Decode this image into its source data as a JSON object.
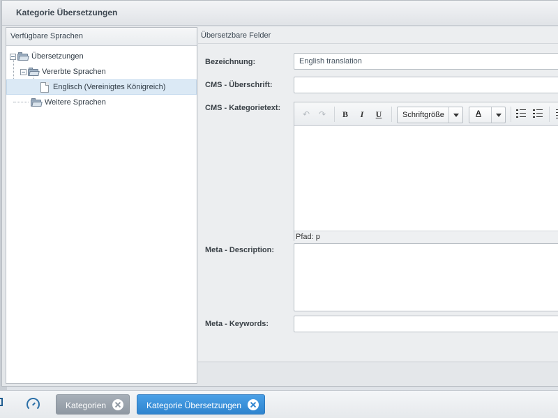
{
  "window": {
    "title": "Kategorie Übersetzungen"
  },
  "left_panel": {
    "header": "Verfügbare Sprachen",
    "tree": [
      {
        "label": "Übersetzungen",
        "icon": "folder-icon",
        "level": 0
      },
      {
        "label": "Vererbte Sprachen",
        "icon": "folder-icon",
        "level": 1
      },
      {
        "label": "Englisch (Vereinigtes Königreich)",
        "icon": "document-icon",
        "level": 2,
        "selected": true
      },
      {
        "label": "Weitere Sprachen",
        "icon": "folder-icon",
        "level": 1
      }
    ]
  },
  "right_panel": {
    "header": "Übersetzbare Felder",
    "fields": {
      "bezeichnung": {
        "label": "Bezeichnung:",
        "value": "English translation"
      },
      "cms_ueberschrift": {
        "label": "CMS - Überschrift:",
        "value": ""
      },
      "cms_kategorietext": {
        "label": "CMS - Kategorietext:"
      },
      "meta_description": {
        "label": "Meta - Description:",
        "value": ""
      },
      "meta_keywords": {
        "label": "Meta - Keywords:",
        "value": ""
      }
    },
    "editor": {
      "font_size_select": "Schriftgröße",
      "text_color_glyph": "A",
      "path_label": "Pfad: p",
      "buttons": [
        "undo-icon",
        "redo-icon",
        "bold",
        "italic",
        "underline",
        "unordered-list-icon",
        "ordered-list-icon",
        "align-icon"
      ],
      "bold_glyph": "B",
      "italic_glyph": "I",
      "underline_glyph": "U",
      "undo_glyph": "↶",
      "redo_glyph": "↷"
    }
  },
  "taskbar": {
    "tasks": [
      {
        "label": "Kategorien",
        "active": false
      },
      {
        "label": "Kategorie Übersetzungen",
        "active": true
      }
    ]
  },
  "colors": {
    "active_task": "#2f84cf",
    "inactive_task": "#8f98a2",
    "selection": "#dbe9f5"
  }
}
